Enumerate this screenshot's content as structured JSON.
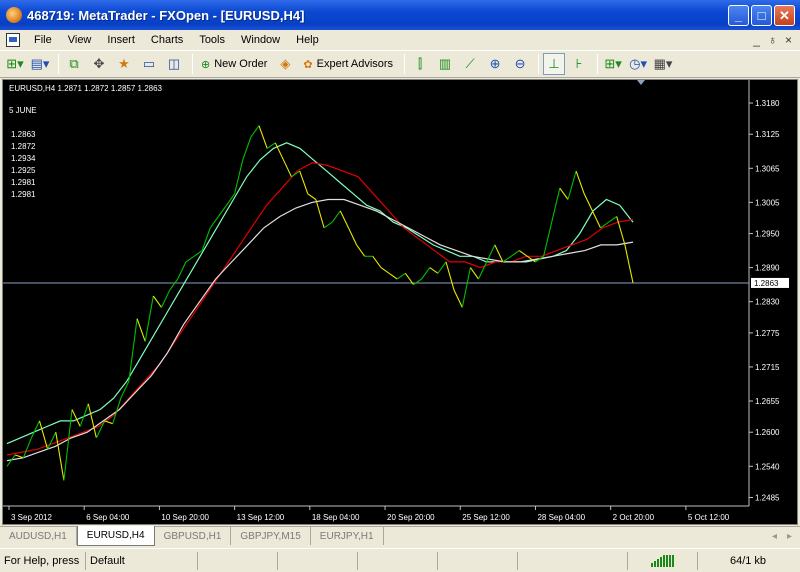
{
  "window": {
    "title": "468719: MetaTrader - FXOpen - [EURUSD,H4]",
    "minimize_glyph": "_",
    "maximize_glyph": "□",
    "close_glyph": "✕"
  },
  "menu": {
    "items": [
      {
        "label": "File"
      },
      {
        "label": "View"
      },
      {
        "label": "Insert"
      },
      {
        "label": "Charts"
      },
      {
        "label": "Tools"
      },
      {
        "label": "Window"
      },
      {
        "label": "Help"
      }
    ],
    "mdi_minimize": "_",
    "mdi_restore": "♁",
    "mdi_close": "×"
  },
  "toolbar": {
    "new_order_label": "New Order",
    "expert_advisors_label": "Expert Advisors",
    "icons": [
      "new-chart-icon",
      "profiles-icon",
      "market-watch-icon",
      "crosshair-icon",
      "navigator-icon",
      "terminal-icon",
      "strategy-tester-icon",
      "bar-chart-icon",
      "candlestick-icon",
      "line-chart-icon",
      "zoom-in-icon",
      "zoom-out-icon",
      "chart-shift-icon",
      "autoscroll-icon",
      "indicators-icon",
      "periods-icon",
      "templates-icon"
    ]
  },
  "chart": {
    "header_line": "EURUSD,H4  1.2871 1.2872 1.2857 1.2863",
    "date_label": "5 JUNE",
    "info_values": [
      "1.2863",
      "1.2872",
      "1.2934",
      "1.2925",
      "1.2981",
      "1.2981"
    ],
    "price_ticks": [
      "1.3180",
      "1.3125",
      "1.3065",
      "1.3005",
      "1.2950",
      "1.2890",
      "1.2830",
      "1.2775",
      "1.2715",
      "1.2655",
      "1.2600",
      "1.2540",
      "1.2485"
    ],
    "current_price": "1.2863",
    "time_ticks": [
      "3 Sep 2012",
      "6 Sep 04:00",
      "10 Sep 20:00",
      "13 Sep 12:00",
      "18 Sep 04:00",
      "20 Sep 20:00",
      "25 Sep 12:00",
      "28 Sep 04:00",
      "2 Oct 20:00",
      "5 Oct 12:00"
    ],
    "colors": {
      "background": "#000000",
      "price_up": "#00c000",
      "price_down": "#e8e800",
      "ma_fast": "#80ffc0",
      "ma_mid": "#e00000",
      "ma_slow": "#e0e0e0",
      "price_line": "#8ca0c0"
    }
  },
  "chart_data": {
    "type": "line",
    "ylim": [
      1.247,
      1.321
    ],
    "price": [
      1.254,
      1.256,
      1.2555,
      1.259,
      1.262,
      1.257,
      1.26,
      1.2515,
      1.264,
      1.261,
      1.265,
      1.259,
      1.262,
      1.2615,
      1.266,
      1.269,
      1.28,
      1.276,
      1.284,
      1.282,
      1.285,
      1.287,
      1.29,
      1.291,
      1.292,
      1.296,
      1.298,
      1.3,
      1.302,
      1.308,
      1.312,
      1.314,
      1.31,
      1.311,
      1.308,
      1.305,
      1.306,
      1.302,
      1.301,
      1.296,
      1.297,
      1.299,
      1.296,
      1.293,
      1.291,
      1.291,
      1.289,
      1.288,
      1.287,
      1.288,
      1.286,
      1.287,
      1.289,
      1.288,
      1.29,
      1.285,
      1.282,
      1.289,
      1.287,
      1.29,
      1.293,
      1.29,
      1.291,
      1.292,
      1.291,
      1.29,
      1.291,
      1.297,
      1.303,
      1.301,
      1.306,
      1.302,
      1.299,
      1.296,
      1.297,
      1.298,
      1.293,
      1.2863
    ],
    "series": [
      {
        "values": [
          1.258,
          1.259,
          1.26,
          1.261,
          1.262,
          1.262,
          1.263,
          1.264,
          1.266,
          1.269,
          1.273,
          1.277,
          1.281,
          1.285,
          1.289,
          1.293,
          1.297,
          1.301,
          1.305,
          1.308,
          1.31,
          1.311,
          1.31,
          1.308,
          1.306,
          1.304,
          1.302,
          1.3,
          1.299,
          1.297,
          1.296,
          1.2945,
          1.293,
          1.292,
          1.291,
          1.291,
          1.29,
          1.29,
          1.29,
          1.29,
          1.2905,
          1.291,
          1.292,
          1.295,
          1.299,
          1.301,
          1.3,
          1.297
        ]
      },
      {
        "values": [
          1.256,
          1.2565,
          1.257,
          1.258,
          1.259,
          1.26,
          1.261,
          1.263,
          1.266,
          1.269,
          1.272,
          1.276,
          1.28,
          1.284,
          1.288,
          1.292,
          1.296,
          1.3,
          1.303,
          1.306,
          1.3075,
          1.307,
          1.306,
          1.305,
          1.302,
          1.299,
          1.296,
          1.294,
          1.292,
          1.29,
          1.29,
          1.289,
          1.29,
          1.29,
          1.291,
          1.291,
          1.292,
          1.293,
          1.294,
          1.296,
          1.297,
          1.2975
        ]
      },
      {
        "values": [
          1.255,
          1.2555,
          1.2565,
          1.2575,
          1.259,
          1.26,
          1.262,
          1.264,
          1.267,
          1.27,
          1.274,
          1.279,
          1.283,
          1.287,
          1.29,
          1.293,
          1.296,
          1.298,
          1.2995,
          1.3005,
          1.301,
          1.301,
          1.3,
          1.299,
          1.2975,
          1.296,
          1.2945,
          1.293,
          1.292,
          1.291,
          1.2905,
          1.29,
          1.29,
          1.2905,
          1.291,
          1.2915,
          1.292,
          1.293,
          1.293,
          1.2935
        ]
      }
    ]
  },
  "tabs": [
    {
      "label": "AUDUSD,H1",
      "active": false
    },
    {
      "label": "EURUSD,H4",
      "active": true
    },
    {
      "label": "GBPUSD,H1",
      "active": false
    },
    {
      "label": "GBPJPY,M15",
      "active": false
    },
    {
      "label": "EURJPY,H1",
      "active": false
    }
  ],
  "status": {
    "help_text": "For Help, press",
    "profile": "Default",
    "traffic": "64/1 kb"
  }
}
